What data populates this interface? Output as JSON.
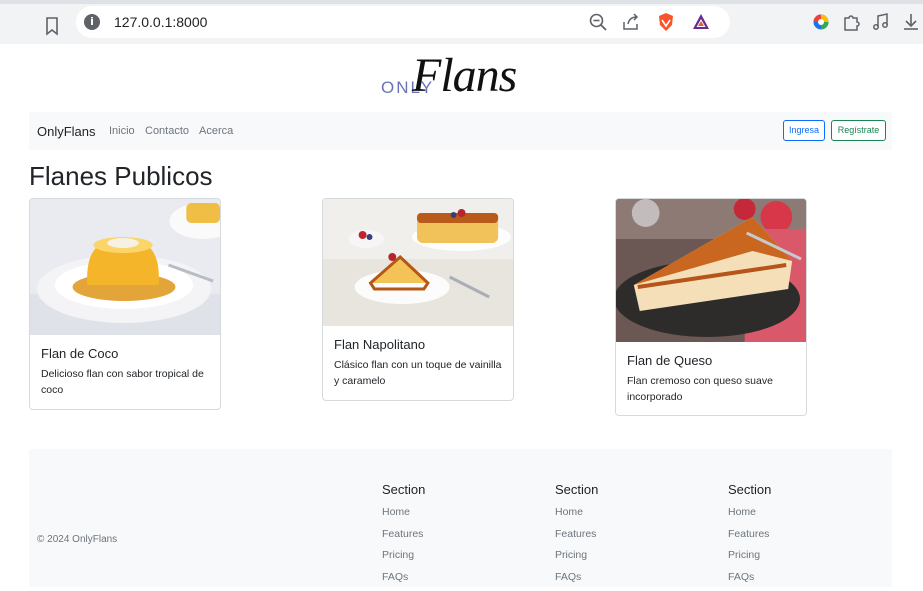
{
  "browser": {
    "url": "127.0.0.1:8000"
  },
  "logo": {
    "prefix": "ONLY",
    "main": "Flans"
  },
  "navbar": {
    "brand": "OnlyFlans",
    "links": [
      "Inicio",
      "Contacto",
      "Acerca"
    ],
    "login_label": "Ingresa",
    "register_label": "Regístrate"
  },
  "main": {
    "title": "Flanes Publicos",
    "cards": [
      {
        "title": "Flan de Coco",
        "text": "Delicioso flan con sabor tropical de coco"
      },
      {
        "title": "Flan Napolitano",
        "text": "Clásico flan con un toque de vainilla y caramelo"
      },
      {
        "title": "Flan de Queso",
        "text": "Flan cremoso con queso suave incorporado"
      }
    ]
  },
  "footer": {
    "copyright": "© 2024 OnlyFlans",
    "columns": [
      {
        "heading": "Section",
        "links": [
          "Home",
          "Features",
          "Pricing",
          "FAQs"
        ]
      },
      {
        "heading": "Section",
        "links": [
          "Home",
          "Features",
          "Pricing",
          "FAQs"
        ]
      },
      {
        "heading": "Section",
        "links": [
          "Home",
          "Features",
          "Pricing",
          "FAQs"
        ]
      }
    ]
  },
  "colors": {
    "primary": "#0d6efd",
    "success": "#198754",
    "caramel": "#c8651b",
    "logo_accent": "#6a73b9"
  }
}
